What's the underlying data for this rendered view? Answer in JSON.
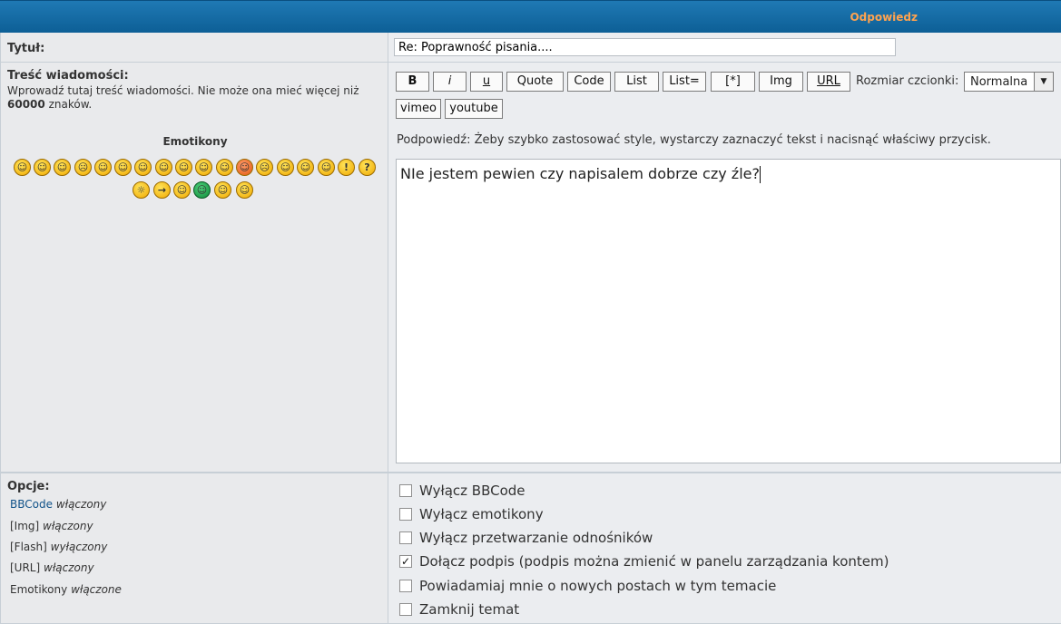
{
  "header": {
    "title": "Odpowiedz"
  },
  "subject": {
    "label": "Tytuł:",
    "value": "Re: Poprawność pisania...."
  },
  "message": {
    "label": "Treść wiadomości:",
    "help_line1": "Wprowadź tutaj treść wiadomości. Nie może ona mieć więcej niż",
    "limit_number": "60000",
    "limit_suffix": "znaków.",
    "emoticons_title": "Emotikony",
    "text": "NIe jestem pewien czy napisalem dobrze czy źle?"
  },
  "toolbar": {
    "b": "B",
    "i": "i",
    "u": "u",
    "quote": "Quote",
    "code": "Code",
    "list": "List",
    "list_eq": "List=",
    "star": "[*]",
    "img": "Img",
    "url": "URL",
    "font_size_label": "Rozmiar czcionki:",
    "font_size_value": "Normalna",
    "vimeo": "vimeo",
    "youtube": "youtube",
    "hint": "Podpowiedź: Żeby szybko zastosować style, wystarczy zaznaczyć tekst i nacisnąć właściwy przycisk."
  },
  "options": {
    "label": "Opcje:",
    "bbcode_link": "BBCode",
    "bbcode_state": "włączony",
    "img": "[Img]",
    "img_state": "włączony",
    "flash": "[Flash]",
    "flash_state": "wyłączony",
    "url": "[URL]",
    "url_state": "włączony",
    "emoticons": "Emotikony",
    "emoticons_state": "włączone",
    "checkboxes": [
      {
        "label": "Wyłącz BBCode",
        "checked": false
      },
      {
        "label": "Wyłącz emotikony",
        "checked": false
      },
      {
        "label": "Wyłącz przetwarzanie odnośników",
        "checked": false
      },
      {
        "label": "Dołącz podpis (podpis można zmienić w panelu zarządzania kontem)",
        "checked": true
      },
      {
        "label": "Powiadamiaj mnie o nowych postach w tym temacie",
        "checked": false
      },
      {
        "label": "Zamknij temat",
        "checked": false
      }
    ]
  },
  "colors": {
    "header": "#0d5f96",
    "header_title": "#ffa34f",
    "link": "#105289"
  }
}
